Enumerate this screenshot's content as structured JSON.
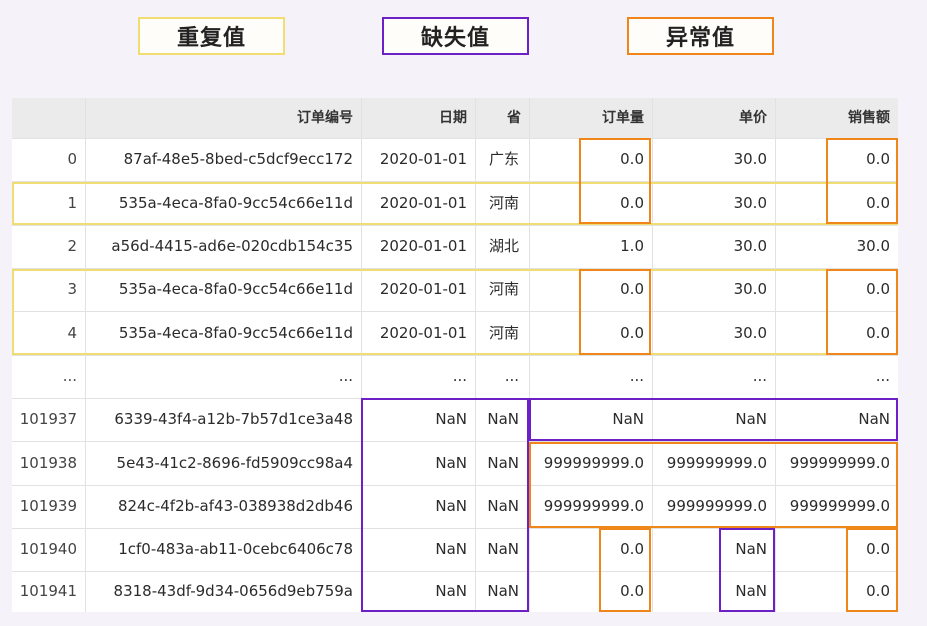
{
  "legend": {
    "duplicate": "重复值",
    "missing": "缺失值",
    "abnormal": "异常值"
  },
  "colors": {
    "duplicate": "#f1dd72",
    "missing": "#6c20c6",
    "abnormal": "#f0861a",
    "header_bg": "#ebebeb",
    "page_bg": "#f6f2f9"
  },
  "table": {
    "columns": [
      "",
      "订单编号",
      "日期",
      "省",
      "订单量",
      "单价",
      "销售额"
    ],
    "rows": [
      [
        "0",
        "87af-48e5-8bed-c5dcf9ecc172",
        "2020-01-01",
        "广东",
        "0.0",
        "30.0",
        "0.0"
      ],
      [
        "1",
        "535a-4eca-8fa0-9cc54c66e11d",
        "2020-01-01",
        "河南",
        "0.0",
        "30.0",
        "0.0"
      ],
      [
        "2",
        "a56d-4415-ad6e-020cdb154c35",
        "2020-01-01",
        "湖北",
        "1.0",
        "30.0",
        "30.0"
      ],
      [
        "3",
        "535a-4eca-8fa0-9cc54c66e11d",
        "2020-01-01",
        "河南",
        "0.0",
        "30.0",
        "0.0"
      ],
      [
        "4",
        "535a-4eca-8fa0-9cc54c66e11d",
        "2020-01-01",
        "河南",
        "0.0",
        "30.0",
        "0.0"
      ],
      [
        "...",
        "...",
        "...",
        "...",
        "...",
        "...",
        "..."
      ],
      [
        "101937",
        "6339-43f4-a12b-7b57d1ce3a48",
        "NaN",
        "NaN",
        "NaN",
        "NaN",
        "NaN"
      ],
      [
        "101938",
        "5e43-41c2-8696-fd5909cc98a4",
        "NaN",
        "NaN",
        "999999999.0",
        "999999999.0",
        "999999999.0"
      ],
      [
        "101939",
        "824c-4f2b-af43-038938d2db46",
        "NaN",
        "NaN",
        "999999999.0",
        "999999999.0",
        "999999999.0"
      ],
      [
        "101940",
        "1cf0-483a-ab11-0cebc6406c78",
        "NaN",
        "NaN",
        "0.0",
        "NaN",
        "0.0"
      ],
      [
        "101941",
        "8318-43df-9d34-0656d9eb759a",
        "NaN",
        "NaN",
        "0.0",
        "NaN",
        "0.0"
      ]
    ]
  }
}
